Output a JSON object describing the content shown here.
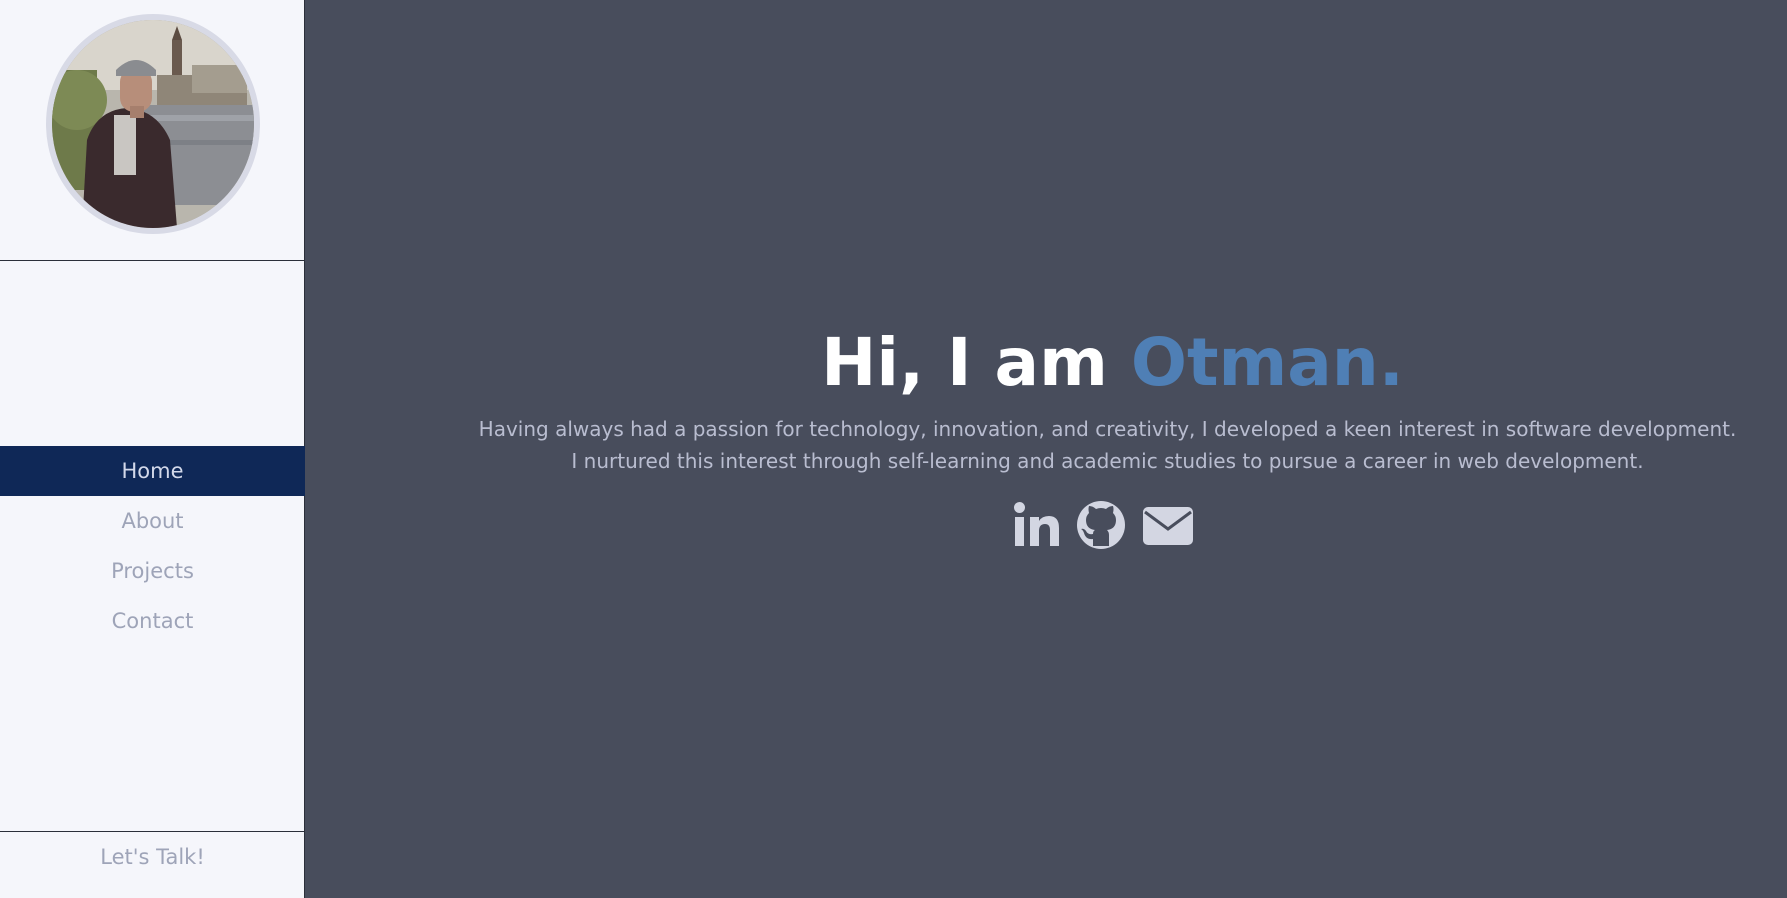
{
  "sidebar": {
    "avatar_alt": "Profile photo",
    "nav": [
      {
        "label": "Home",
        "active": true
      },
      {
        "label": "About",
        "active": false
      },
      {
        "label": "Projects",
        "active": false
      },
      {
        "label": "Contact",
        "active": false
      }
    ],
    "cta_label": "Let's Talk!"
  },
  "hero": {
    "greeting": "Hi, I am ",
    "name": "Otman.",
    "intro": "Having always had a passion for technology, innovation, and creativity, I developed a keen interest in software development. I nurtured this interest through self-learning and academic studies to pursue a career in web development.",
    "socials": [
      {
        "icon": "linkedin-icon"
      },
      {
        "icon": "github-icon"
      },
      {
        "icon": "email-icon"
      }
    ]
  },
  "colors": {
    "sidebar_bg": "#f5f6fb",
    "main_bg": "#484d5c",
    "active_nav_bg": "#0f2857",
    "accent": "#4f7fb5",
    "nav_text": "#9ea4b8",
    "icon": "#d3d6e2"
  }
}
